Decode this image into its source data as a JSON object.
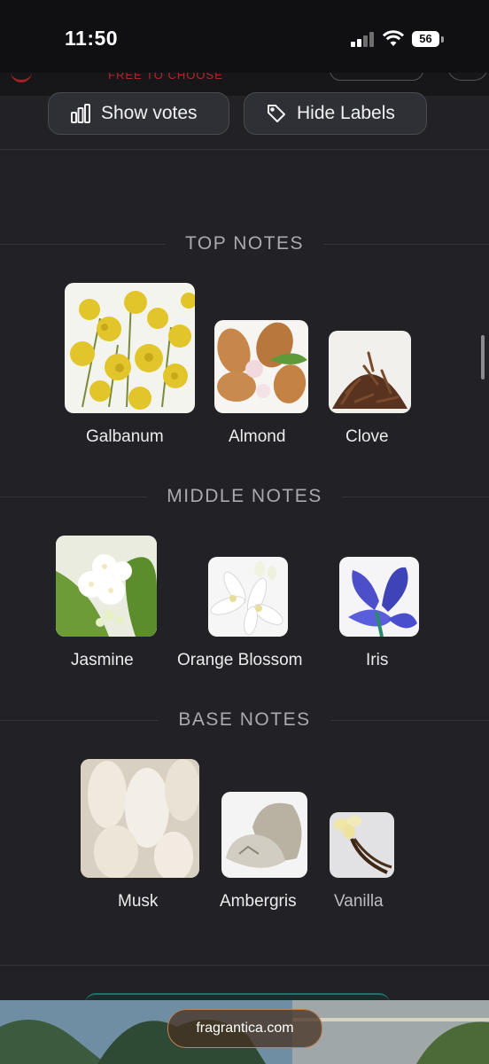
{
  "status": {
    "time": "11:50",
    "battery": "56"
  },
  "hidden_banner": {
    "text": "FREE TO CHOOSE"
  },
  "toolbar": {
    "show_votes": "Show votes",
    "hide_labels": "Hide Labels"
  },
  "sections": {
    "top": {
      "title": "TOP NOTES",
      "notes": [
        {
          "label": "Galbanum"
        },
        {
          "label": "Almond"
        },
        {
          "label": "Clove"
        }
      ]
    },
    "middle": {
      "title": "MIDDLE NOTES",
      "notes": [
        {
          "label": "Jasmine"
        },
        {
          "label": "Orange Blossom"
        },
        {
          "label": "Iris"
        }
      ]
    },
    "base": {
      "title": "BASE NOTES",
      "notes": [
        {
          "label": "Musk"
        },
        {
          "label": "Ambergris"
        },
        {
          "label": "Vanilla"
        }
      ]
    }
  },
  "footer": {
    "site": "fragrantica.com"
  }
}
